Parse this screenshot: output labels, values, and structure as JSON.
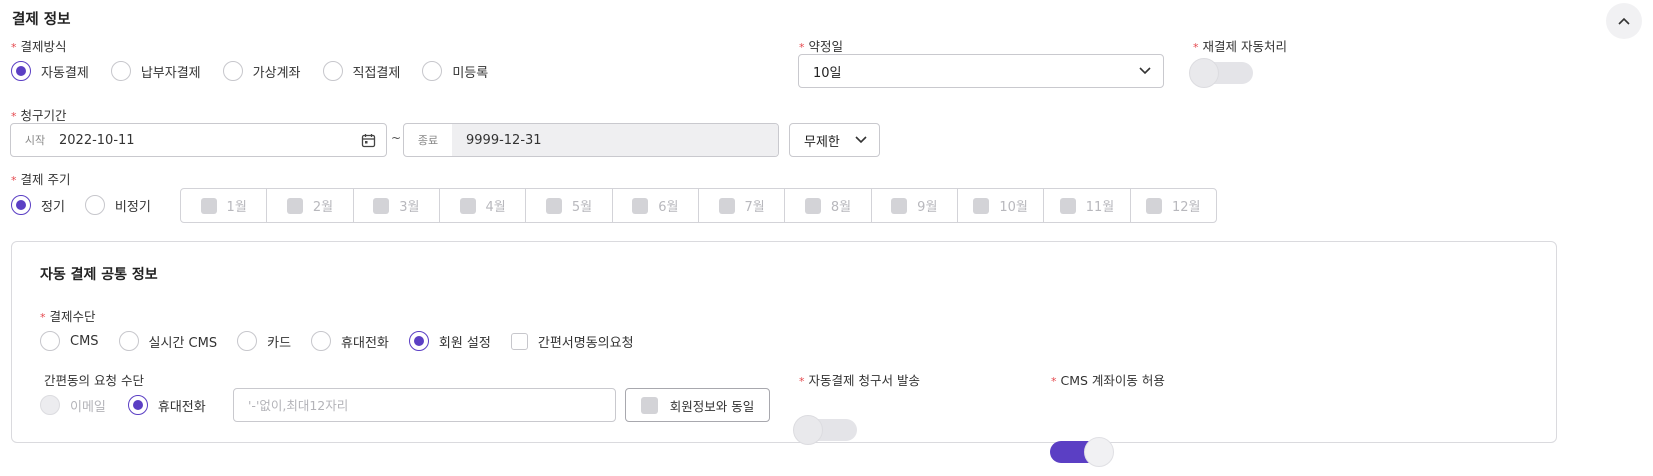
{
  "section_title": "결제 정보",
  "payment_method": {
    "label": "결제방식",
    "options": [
      "자동결제",
      "납부자결제",
      "가상계좌",
      "직접결제",
      "미등록"
    ],
    "selected": "자동결제"
  },
  "agreed_day": {
    "label": "약정일",
    "value": "10일"
  },
  "retry_auto": {
    "label": "재결제 자동처리",
    "on": false
  },
  "billing_period": {
    "label": "청구기간",
    "start_prefix": "시작",
    "start_value": "2022-10-11",
    "separator": "~",
    "end_prefix": "종료",
    "end_value": "9999-12-31",
    "limit_value": "무제한"
  },
  "payment_cycle": {
    "label": "결제 주기",
    "options": [
      "정기",
      "비정기"
    ],
    "selected": "정기",
    "months": [
      "1월",
      "2월",
      "3월",
      "4월",
      "5월",
      "6월",
      "7월",
      "8월",
      "9월",
      "10월",
      "11월",
      "12월"
    ]
  },
  "auto_panel": {
    "title": "자동 결제 공통 정보",
    "means_label": "결제수단",
    "means_options": [
      "CMS",
      "실시간 CMS",
      "카드",
      "휴대전화",
      "회원 설정"
    ],
    "means_selected": "회원 설정",
    "simple_sign_checkbox": "간편서명동의요청",
    "simple_agree_label": "간편동의 요청 수단",
    "simple_agree_options": [
      "이메일",
      "휴대전화"
    ],
    "simple_agree_selected": "휴대전화",
    "phone_placeholder": "'-'없이,최대12자리",
    "same_as_member": "회원정보와 동일",
    "invoice_label": "자동결제 청구서 발송",
    "invoice_on": false,
    "cms_move_label": "CMS 계좌이동 허용",
    "cms_move_on": true
  },
  "colors": {
    "accent": "#5b3fc4",
    "required": "#e5484d"
  }
}
